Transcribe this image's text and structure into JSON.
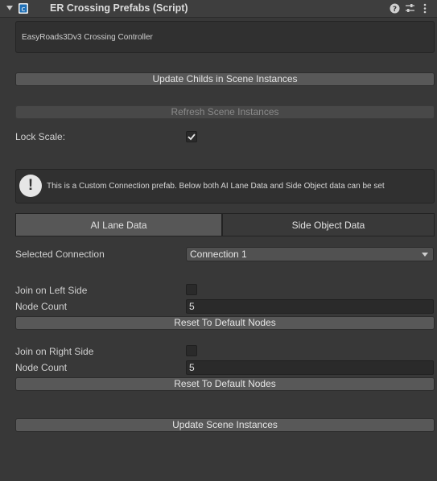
{
  "header": {
    "title": "ER Crossing Prefabs (Script)"
  },
  "info_box": {
    "text": "EasyRoads3Dv3 Crossing Controller"
  },
  "buttons": {
    "update_childs": "Update Childs in Scene Instances",
    "refresh_scene": "Refresh Scene Instances",
    "reset_left": "Reset To Default Nodes",
    "reset_right": "Reset To Default Nodes",
    "update_scene": "Update Scene Instances"
  },
  "lock_scale": {
    "label": "Lock Scale:",
    "checked": true
  },
  "warning": {
    "text": "This is a Custom Connection prefab. Below both AI Lane Data and Side Object data can be set"
  },
  "tabs": [
    {
      "label": "AI Lane Data",
      "active": true
    },
    {
      "label": "Side Object Data",
      "active": false
    }
  ],
  "selected_connection": {
    "label": "Selected Connection",
    "value": "Connection 1"
  },
  "left_side": {
    "join_label": "Join on Left Side",
    "joined": false,
    "node_count_label": "Node Count",
    "node_count": "5"
  },
  "right_side": {
    "join_label": "Join on Right Side",
    "joined": false,
    "node_count_label": "Node Count",
    "node_count": "5"
  },
  "icons": {
    "script": "script-icon",
    "help": "help-icon",
    "presets": "presets-icon",
    "menu": "kebab-menu-icon",
    "warning": "warning-icon"
  }
}
